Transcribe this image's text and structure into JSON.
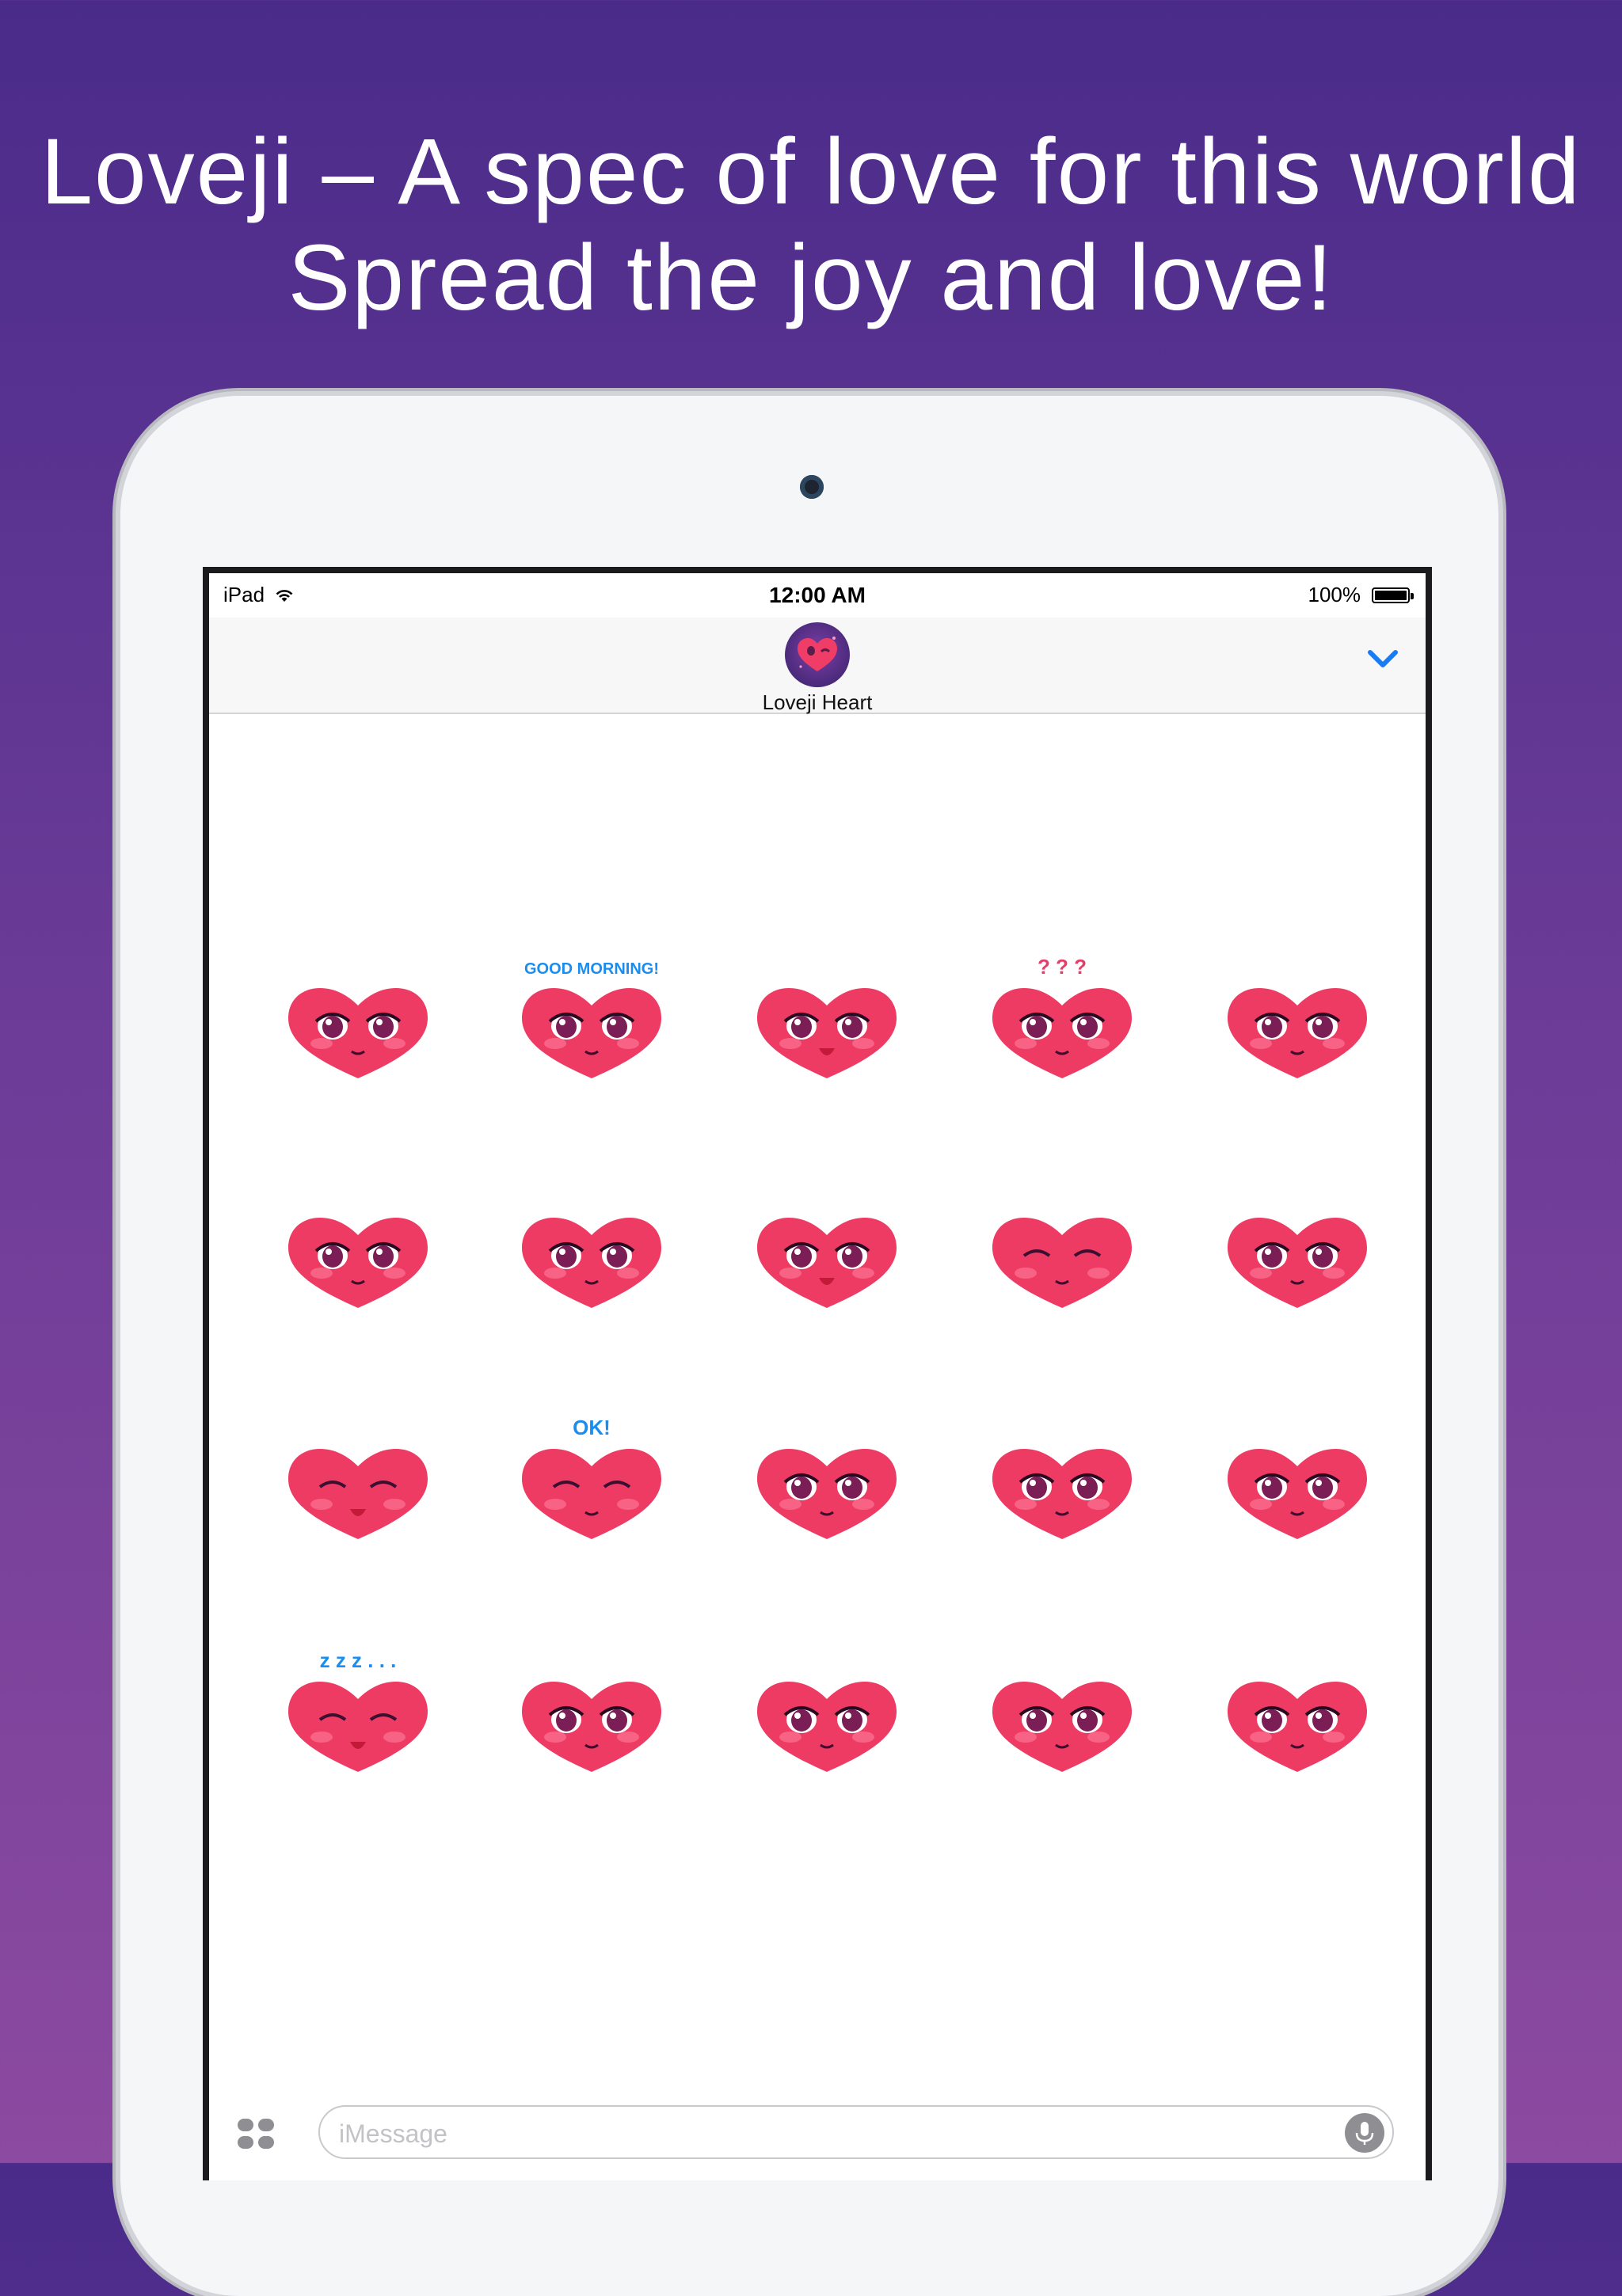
{
  "headline": {
    "line1": "Loveji – A spec of love for this world",
    "line2": "Spread the joy and love!"
  },
  "status_bar": {
    "device": "iPad",
    "time": "12:00 AM",
    "battery": "100%",
    "battery_level": 1.0
  },
  "nav": {
    "app_name": "Loveji Heart",
    "chevron_icon": "chevron-down-icon"
  },
  "stickers": [
    {
      "id": "big-eyes-smile",
      "caption": ""
    },
    {
      "id": "good-morning-coffee",
      "caption": "GOOD MORNING!"
    },
    {
      "id": "surprised-hearts",
      "caption": ""
    },
    {
      "id": "confused",
      "caption": "? ? ?"
    },
    {
      "id": "worried",
      "caption": ""
    },
    {
      "id": "crying",
      "caption": ""
    },
    {
      "id": "pouting",
      "caption": ""
    },
    {
      "id": "grinning",
      "caption": ""
    },
    {
      "id": "winking-hands",
      "caption": ""
    },
    {
      "id": "sad",
      "caption": ""
    },
    {
      "id": "laughing",
      "caption": ""
    },
    {
      "id": "ok-hand",
      "caption": "OK!"
    },
    {
      "id": "staring",
      "caption": ""
    },
    {
      "id": "praying",
      "caption": ""
    },
    {
      "id": "smug",
      "caption": ""
    },
    {
      "id": "sleeping",
      "caption": "z z z . . ."
    },
    {
      "id": "tongue-out",
      "caption": ""
    },
    {
      "id": "head-scratch",
      "caption": ""
    },
    {
      "id": "teary",
      "caption": ""
    },
    {
      "id": "smirk",
      "caption": ""
    }
  ],
  "compose": {
    "placeholder": "iMessage",
    "apps_icon": "app-drawer-icon",
    "mic_icon": "microphone-icon"
  },
  "colors": {
    "background_top": "#4a2b8a",
    "background_bottom": "#8c4aa0",
    "heart": "#ee3b63",
    "accent_blue": "#1a7cf5"
  }
}
